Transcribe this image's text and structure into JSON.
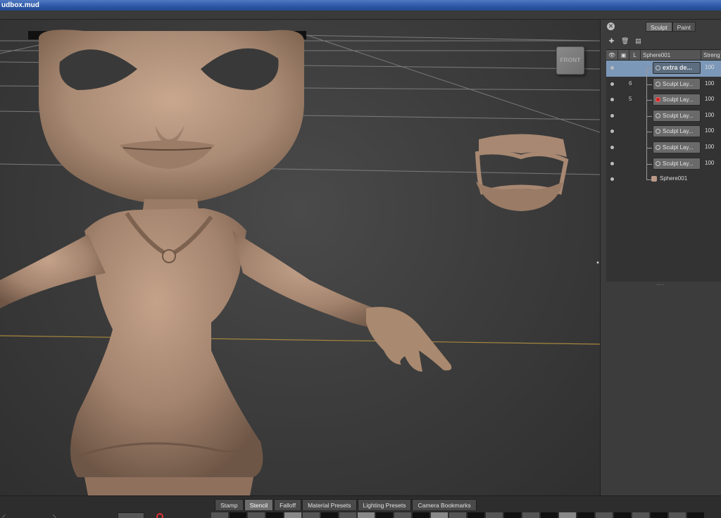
{
  "app": {
    "title": "udbox.mud"
  },
  "viewport": {
    "view_cube_label": "FRONT"
  },
  "right_panel": {
    "close_icon": "close-icon",
    "mode_tabs": [
      "Sculpt",
      "Paint"
    ],
    "active_mode": "Sculpt",
    "toolbar_icons": [
      "new-layer-icon",
      "delete-layer-icon",
      "merge-layer-icon"
    ],
    "columns": {
      "visibility": "eye-icon",
      "lock": "lock-icon",
      "l": "L",
      "name": "Sphere001",
      "strength": "Streng"
    },
    "layers": [
      {
        "name": "extra de...",
        "lock": "",
        "strength": "100",
        "selected": true,
        "glyph": "brush"
      },
      {
        "name": "Sculpt Lay...",
        "lock": "6",
        "strength": "100",
        "selected": false,
        "glyph": "brush"
      },
      {
        "name": "Sculpt Lay...",
        "lock": "5",
        "strength": "100",
        "selected": false,
        "glyph": "recording"
      },
      {
        "name": "Sculpt Lay...",
        "lock": "",
        "strength": "100",
        "selected": false,
        "glyph": "brush"
      },
      {
        "name": "Sculpt Lay...",
        "lock": "",
        "strength": "100",
        "selected": false,
        "glyph": "brush"
      },
      {
        "name": "Sculpt Lay...",
        "lock": "",
        "strength": "100",
        "selected": false,
        "glyph": "brush"
      },
      {
        "name": "Sculpt Lay...",
        "lock": "",
        "strength": "100",
        "selected": false,
        "glyph": "brush"
      }
    ],
    "mesh": {
      "name": "Sphere001",
      "icon": "mesh-icon"
    }
  },
  "bottom_tabs": {
    "tabs": [
      "Stamp",
      "Stencil",
      "Falloff",
      "Material Presets",
      "Lighting Presets",
      "Camera Bookmarks"
    ],
    "active": "Stencil"
  },
  "colors": {
    "selection": "#7c98b9",
    "clay": "#a88872",
    "viewport_bg": "#3d3d3d",
    "recording_red": "#cc2222"
  }
}
